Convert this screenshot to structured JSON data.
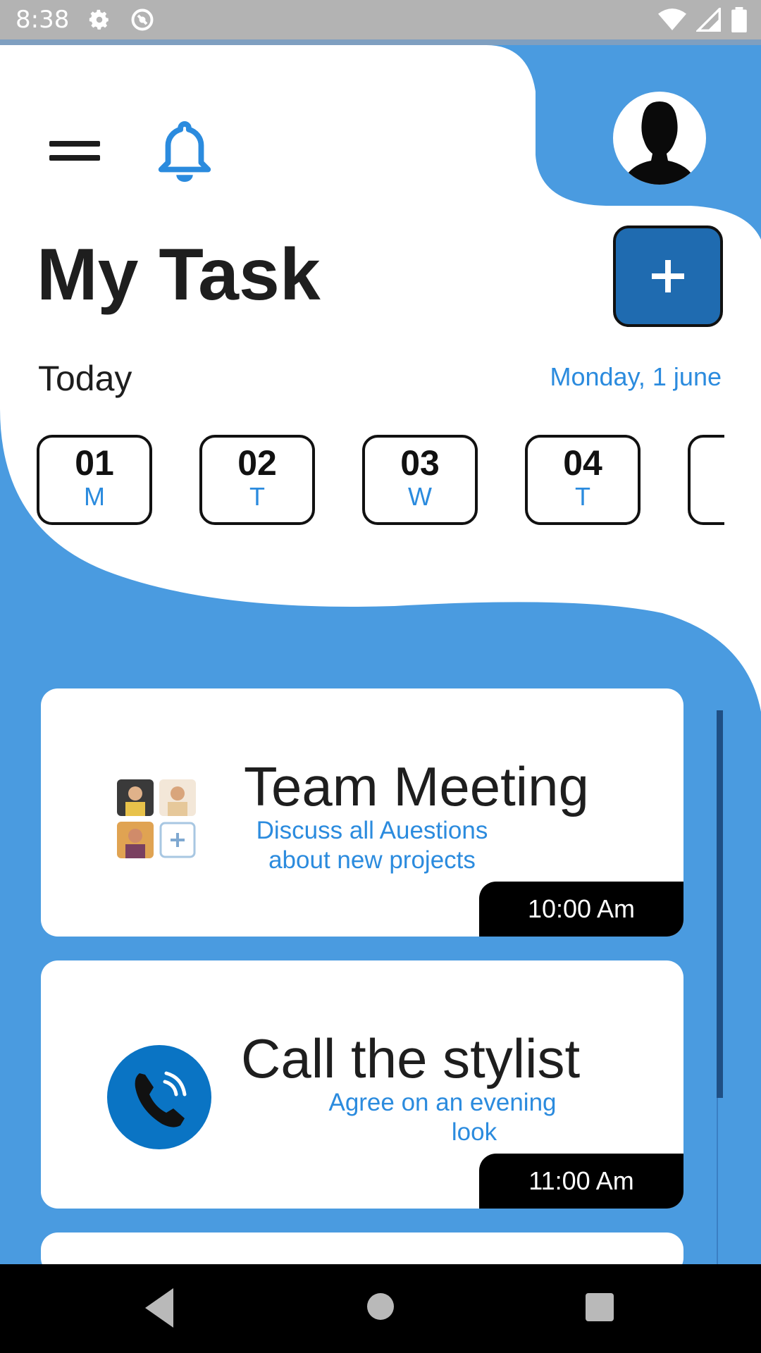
{
  "status_bar": {
    "time": "8:38",
    "icons": [
      "settings-icon",
      "sync-icon",
      "wifi-icon",
      "signal-icon",
      "battery-icon"
    ]
  },
  "header": {
    "menu_icon": "menu-icon",
    "notification_icon": "bell-icon",
    "profile_icon": "avatar"
  },
  "title": "My Task",
  "add_button": {
    "label": "+"
  },
  "today_label": "Today",
  "current_date": "Monday, 1 june",
  "dates": [
    {
      "num": "01",
      "day": "M"
    },
    {
      "num": "02",
      "day": "T"
    },
    {
      "num": "03",
      "day": "W"
    },
    {
      "num": "04",
      "day": "T"
    },
    {
      "num": "",
      "day": ""
    }
  ],
  "tasks": [
    {
      "title": "Team Meeting",
      "desc_line1": "Discuss all Auestions",
      "desc_line2": "about new projects",
      "time": "10:00 Am",
      "icon": "team-members-icon"
    },
    {
      "title": "Call the stylist",
      "desc_line1": "Agree on an evening",
      "desc_line2": "look",
      "time": "11:00 Am",
      "icon": "phone-icon"
    }
  ],
  "colors": {
    "accent": "#4a9be0",
    "button": "#1f6bb0",
    "link": "#2b8bde",
    "text": "#1e1e1e"
  },
  "nav_bar": [
    "back-icon",
    "home-icon",
    "recents-icon"
  ]
}
